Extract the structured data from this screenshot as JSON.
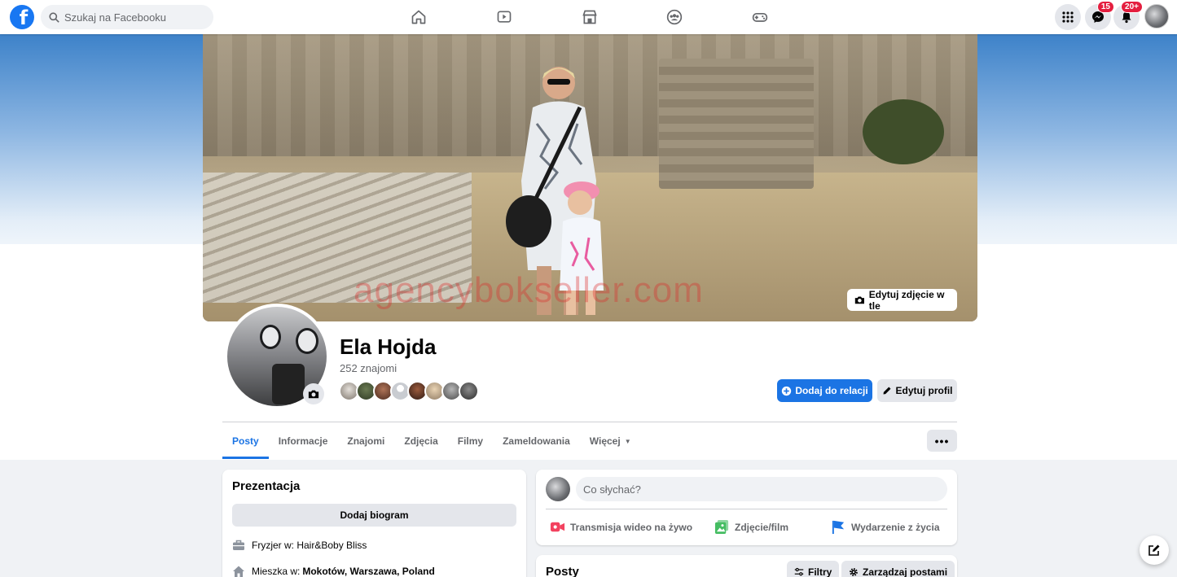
{
  "topbar": {
    "logo_letter": "f",
    "search_placeholder": "Szukaj na Facebooku",
    "nav_icons": [
      "home-icon",
      "watch-icon",
      "marketplace-icon",
      "groups-icon",
      "gaming-icon"
    ],
    "messenger_badge": "15",
    "notifications_badge": "20+"
  },
  "cover": {
    "watermark": "agencybokseller.com",
    "edit_label": "Edytuj zdjęcie w tle"
  },
  "profile": {
    "name": "Ela Hojda",
    "friends_count": "252 znajomi",
    "add_story_label": "Dodaj do relacji",
    "edit_profile_label": "Edytuj profil"
  },
  "tabs": [
    {
      "label": "Posty"
    },
    {
      "label": "Informacje"
    },
    {
      "label": "Znajomi"
    },
    {
      "label": "Zdjęcia"
    },
    {
      "label": "Filmy"
    },
    {
      "label": "Zameldowania"
    },
    {
      "label": "Więcej"
    }
  ],
  "more_button_label": "•••",
  "intro": {
    "title": "Prezentacja",
    "bio_button": "Dodaj biogram",
    "work_prefix": "Fryzjer w: Hair&Boby Bliss",
    "lives_prefix": "Mieszka w:",
    "lives_place": "Mokotów, Warszawa, Poland"
  },
  "composer": {
    "placeholder": "Co słychać?",
    "live_label": "Transmisja wideo na żywo",
    "photo_label": "Zdjęcie/film",
    "life_event_label": "Wydarzenie z życia"
  },
  "posts": {
    "title": "Posty",
    "filters_label": "Filtry",
    "manage_label": "Zarządzaj postami"
  },
  "colors": {
    "brand": "#1877f2",
    "primary_button": "#1b74e4",
    "badge": "#e41e3f",
    "live_red": "#f3425f",
    "photo_green": "#45bd62"
  }
}
